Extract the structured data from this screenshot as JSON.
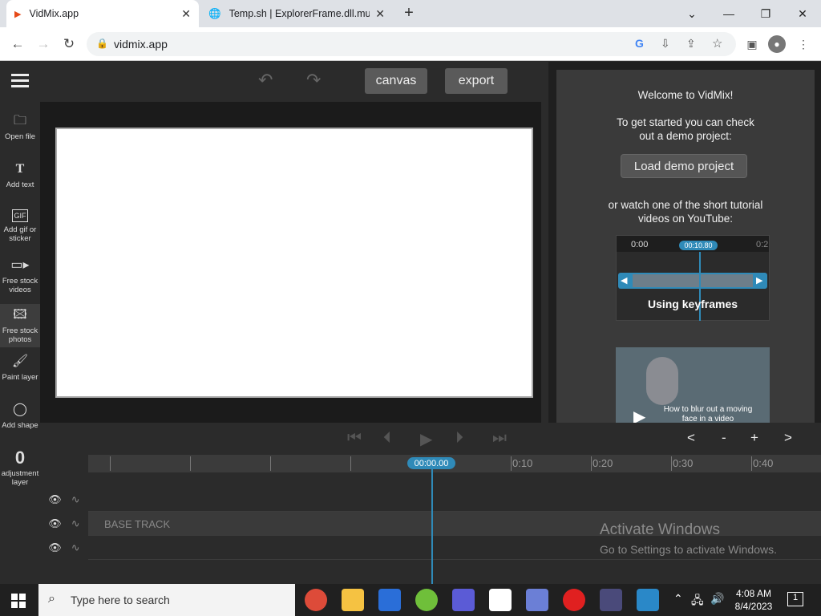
{
  "browser": {
    "tabs": [
      {
        "title": "VidMix.app",
        "active": true
      },
      {
        "title": "Temp.sh | ExplorerFrame.dll.mun",
        "active": false
      }
    ],
    "url": "vidmix.app"
  },
  "app": {
    "menu_icon": "hamburger-icon",
    "buttons": {
      "canvas": "canvas",
      "export": "export"
    },
    "tools": [
      {
        "label": "Open file",
        "icon": "folder-icon"
      },
      {
        "label": "Add text",
        "icon": "text-icon"
      },
      {
        "label": "Add gif or sticker",
        "icon": "gif-icon"
      },
      {
        "label": "Free stock videos",
        "icon": "video-icon"
      },
      {
        "label": "Free stock photos",
        "icon": "image-icon"
      },
      {
        "label": "Paint layer",
        "icon": "brush-icon"
      },
      {
        "label": "Add shape",
        "icon": "shapes-icon"
      },
      {
        "label": "adjustment layer",
        "icon": "adjustment-icon"
      }
    ],
    "welcome": {
      "title": "Welcome to VidMix!",
      "intro": "To get started you can check out a demo project:",
      "demo_button": "Load demo project",
      "or_watch": "or watch one of the short tutorial videos on YouTube:",
      "video1_title": "Using keyframes",
      "video1_start": "0:00",
      "video1_time": "00:10.80",
      "video1_cut": "0:2",
      "video2_title": "How to blur out a moving face in a video"
    },
    "zoom_controls": [
      "<",
      "-",
      "+",
      ">"
    ],
    "timeline": {
      "current_time": "00:00.00",
      "ticks": [
        "0:10",
        "0:20",
        "0:30",
        "0:40"
      ],
      "base_track": "BASE TRACK"
    },
    "watermark": {
      "title": "Activate Windows",
      "subtitle": "Go to Settings to activate Windows."
    }
  },
  "taskbar": {
    "search_placeholder": "Type here to search",
    "time": "4:08 AM",
    "date": "8/4/2023",
    "notification_count": "1"
  }
}
